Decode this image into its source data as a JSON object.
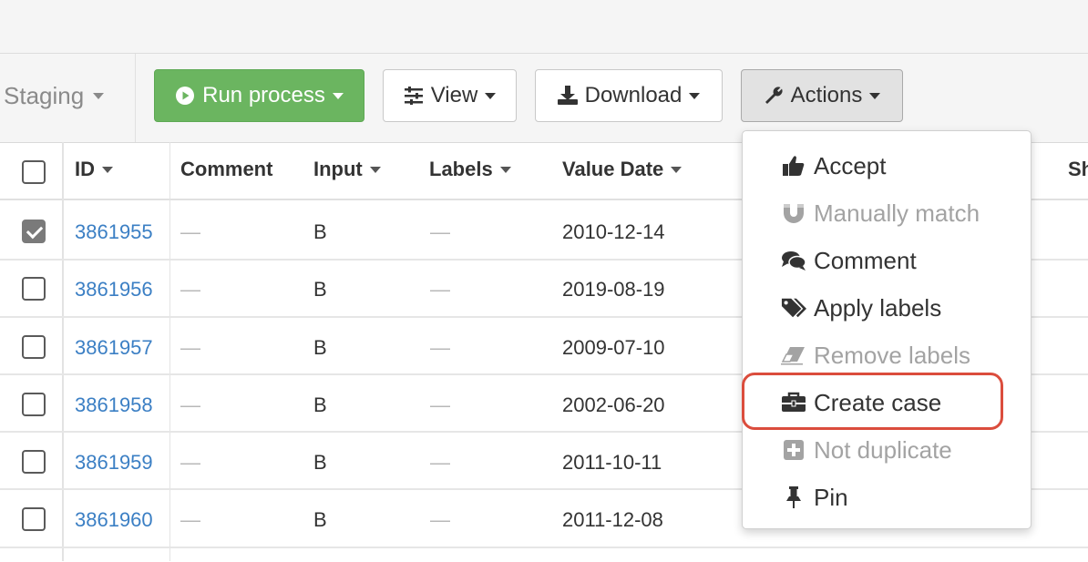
{
  "toolbar": {
    "staging_label": "Staging",
    "run_label": "Run process",
    "view_label": "View",
    "download_label": "Download",
    "actions_label": "Actions"
  },
  "table": {
    "columns": {
      "id": "ID",
      "comment": "Comment",
      "input": "Input",
      "labels": "Labels",
      "value_date": "Value Date",
      "next": "Sh"
    },
    "rows": [
      {
        "id": "3861955",
        "comment": "—",
        "input": "B",
        "labels": "—",
        "value_date": "2010-12-14",
        "checked": true
      },
      {
        "id": "3861956",
        "comment": "—",
        "input": "B",
        "labels": "—",
        "value_date": "2019-08-19",
        "checked": false
      },
      {
        "id": "3861957",
        "comment": "—",
        "input": "B",
        "labels": "—",
        "value_date": "2009-07-10",
        "checked": false
      },
      {
        "id": "3861958",
        "comment": "—",
        "input": "B",
        "labels": "—",
        "value_date": "2002-06-20",
        "checked": false
      },
      {
        "id": "3861959",
        "comment": "—",
        "input": "B",
        "labels": "—",
        "value_date": "2011-10-11",
        "checked": false
      },
      {
        "id": "3861960",
        "comment": "—",
        "input": "B",
        "labels": "—",
        "value_date": "2011-12-08",
        "checked": false
      }
    ]
  },
  "actions_menu": {
    "items": [
      {
        "label": "Accept",
        "icon": "thumbs-up-icon",
        "enabled": true
      },
      {
        "label": "Manually match",
        "icon": "magnet-icon",
        "enabled": false
      },
      {
        "label": "Comment",
        "icon": "comments-icon",
        "enabled": true
      },
      {
        "label": "Apply labels",
        "icon": "tags-icon",
        "enabled": true
      },
      {
        "label": "Remove labels",
        "icon": "eraser-icon",
        "enabled": false
      },
      {
        "label": "Create case",
        "icon": "briefcase-icon",
        "enabled": true,
        "highlighted": true
      },
      {
        "label": "Not duplicate",
        "icon": "plus-square-icon",
        "enabled": false
      },
      {
        "label": "Pin",
        "icon": "thumbtack-icon",
        "enabled": true
      }
    ]
  },
  "colors": {
    "run_button": "#6bb560",
    "link": "#3b7fc4",
    "highlight": "#db4d3d"
  }
}
